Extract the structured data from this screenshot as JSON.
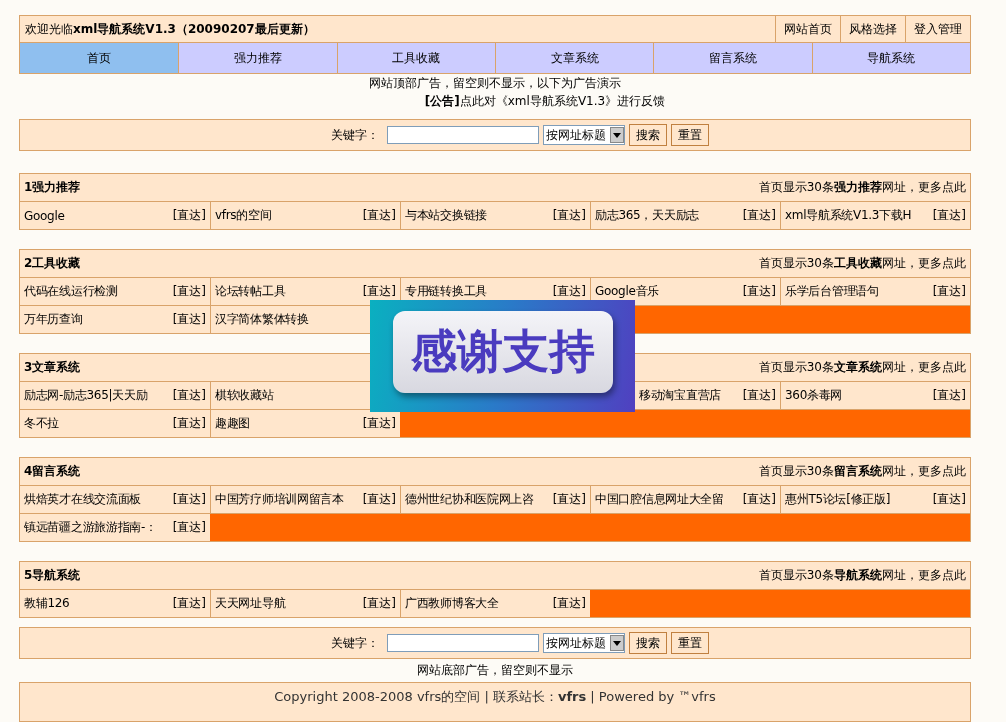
{
  "header": {
    "welcome": "欢迎光临**xml导航系统V1.3（20090207最后更新）**",
    "links": [
      "网站首页",
      "风格选择",
      "登入管理"
    ]
  },
  "nav": [
    {
      "label": "首页",
      "selected": true
    },
    {
      "label": "强力推荐",
      "selected": false
    },
    {
      "label": "工具收藏",
      "selected": false
    },
    {
      "label": "文章系统",
      "selected": false
    },
    {
      "label": "留言系统",
      "selected": false
    },
    {
      "label": "导航系统",
      "selected": false
    }
  ],
  "top_ad": "网站顶部广告，留空则不显示，以下为广告演示",
  "notice": "**[公告]**点此对《xml导航系统V1.3》进行反馈",
  "search_top": {
    "label": "关键字：",
    "select": "按网址标题",
    "buttons": [
      "搜索",
      "重置"
    ]
  },
  "sections": [
    {
      "title": "1强力推荐",
      "more": "首页显示30条**强力推荐**网址，更多点此",
      "rows": [
        [
          {
            "name": "Google",
            "go": "[直达]"
          },
          {
            "name": "vfrs的空间",
            "go": "[直达]"
          },
          {
            "name": "与本站交换链接",
            "go": "[直达]"
          },
          {
            "name": "励志365，天天励志",
            "go": "[直达]"
          },
          {
            "name": "xml导航系统V1.3下载H",
            "go": "[直达]"
          }
        ]
      ]
    },
    {
      "title": "2工具收藏",
      "more": "首页显示30条**工具收藏**网址，更多点此",
      "rows": [
        [
          {
            "name": "代码在线运行检测",
            "go": "[直达]"
          },
          {
            "name": "论坛转帖工具",
            "go": "[直达]"
          },
          {
            "name": "专用链转换工具",
            "go": "[直达]"
          },
          {
            "name": "Google音乐",
            "go": "[直达]"
          },
          {
            "name": "乐学后台管理语句",
            "go": "[直达]"
          }
        ],
        [
          {
            "name": "万年历查询",
            "go": "[直达]"
          },
          {
            "name": "汉字简体繁体转换"
          }
        ]
      ]
    },
    {
      "title": "3文章系统",
      "more": "首页显示30条**文章系统**网址，更多点此",
      "rows": [
        [
          {
            "name": "励志网-励志365|天天励",
            "go": "[直达]"
          },
          {
            "name": "棋软收藏站"
          },
          {},
          {
            "name": "移动淘宝直营店",
            "go": "[直达]",
            "kind": "partial"
          },
          {
            "name": "360杀毒网",
            "go": "[直达]"
          }
        ],
        [
          {
            "name": "冬不拉",
            "go": "[直达]"
          },
          {
            "name": "趣趣图",
            "go": "[直达]"
          }
        ]
      ]
    },
    {
      "title": "4留言系统",
      "more": "首页显示30条**留言系统**网址，更多点此",
      "rows": [
        [
          {
            "name": "烘焙英才在线交流面板",
            "go": "[直达]"
          },
          {
            "name": "中国芳疗师培训网留言本",
            "go": "[直达]"
          },
          {
            "name": "德州世纪协和医院网上咨",
            "go": "[直达]"
          },
          {
            "name": "中国口腔信息网址大全留",
            "go": "[直达]"
          },
          {
            "name": "惠州T5论坛[修正版]",
            "go": "[直达]"
          }
        ],
        [
          {
            "name": "镇远苗疆之游旅游指南-：",
            "go": "[直达]"
          }
        ]
      ]
    },
    {
      "title": "5导航系统",
      "more": "首页显示30条**导航系统**网址，更多点此",
      "rows": [
        [
          {
            "name": "教辅126",
            "go": "[直达]"
          },
          {
            "name": "天天网址导航",
            "go": "[直达]"
          },
          {
            "name": "广西教师博客大全",
            "go": "[直达]"
          }
        ]
      ]
    }
  ],
  "search_bottom": {
    "label": "关键字：",
    "select": "按网址标题",
    "buttons": [
      "搜索",
      "重置"
    ]
  },
  "bottom_ad": "网站底部广告，留空则不显示",
  "copyright": "Copyright 2008-2008 vfrs的空间 | 联系站长：**vfrs** | Powered by ™vfrs",
  "floating_ad": {
    "text": "感谢支持"
  }
}
